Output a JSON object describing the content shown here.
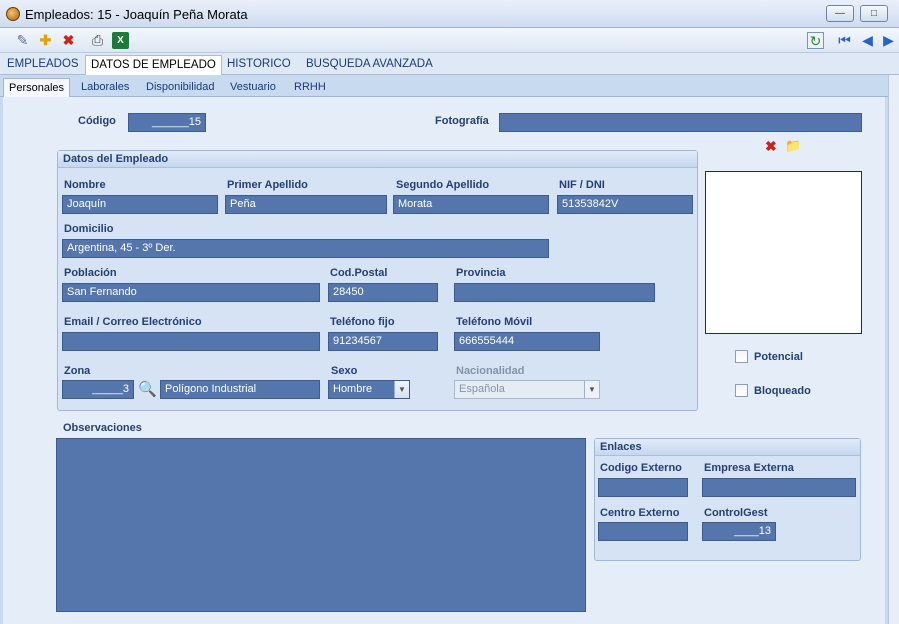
{
  "window": {
    "title": "Empleados: 15 - Joaquín Peña Morata"
  },
  "main_tabs": [
    "EMPLEADOS",
    "DATOS DE EMPLEADO",
    "HISTORICO",
    "BUSQUEDA AVANZADA"
  ],
  "sub_tabs": [
    "Personales",
    "Laborales",
    "Disponibilidad",
    "Vestuario",
    "RRHH"
  ],
  "form": {
    "codigo_label": "Código",
    "codigo_value": "______15",
    "fotografia_label": "Fotografía",
    "fotografia_value": "",
    "datos_group_title": "Datos del Empleado",
    "nombre_label": "Nombre",
    "nombre_value": "Joaquín",
    "primer_apellido_label": "Primer Apellido",
    "primer_apellido_value": "Peña",
    "segundo_apellido_label": "Segundo Apellido",
    "segundo_apellido_value": "Morata",
    "nif_label": "NIF / DNI",
    "nif_value": "51353842V",
    "domicilio_label": "Domicilio",
    "domicilio_value": "Argentina, 45 - 3º Der.",
    "poblacion_label": "Población",
    "poblacion_value": "San Fernando",
    "codpostal_label": "Cod.Postal",
    "codpostal_value": "28450",
    "provincia_label": "Provincia",
    "provincia_value": "",
    "email_label": "Email / Correo Electrónico",
    "email_value": "",
    "telfijo_label": "Teléfono fijo",
    "telfijo_value": "91234567",
    "telmovil_label": "Teléfono Móvil",
    "telmovil_value": "666555444",
    "zona_label": "Zona",
    "zona_code": "_____3",
    "zona_name": "Polígono Industrial",
    "sexo_label": "Sexo",
    "sexo_value": "Hombre",
    "nacionalidad_label": "Nacionalidad",
    "nacionalidad_value": "Española",
    "potencial_label": "Potencial",
    "bloqueado_label": "Bloqueado",
    "observaciones_label": "Observaciones",
    "observaciones_value": ""
  },
  "enlaces": {
    "title": "Enlaces",
    "codigo_externo_label": "Codigo Externo",
    "codigo_externo_value": "",
    "empresa_externa_label": "Empresa Externa",
    "empresa_externa_value": "",
    "centro_externo_label": "Centro Externo",
    "centro_externo_value": "",
    "controlgest_label": "ControlGest",
    "controlgest_value": "____13"
  }
}
